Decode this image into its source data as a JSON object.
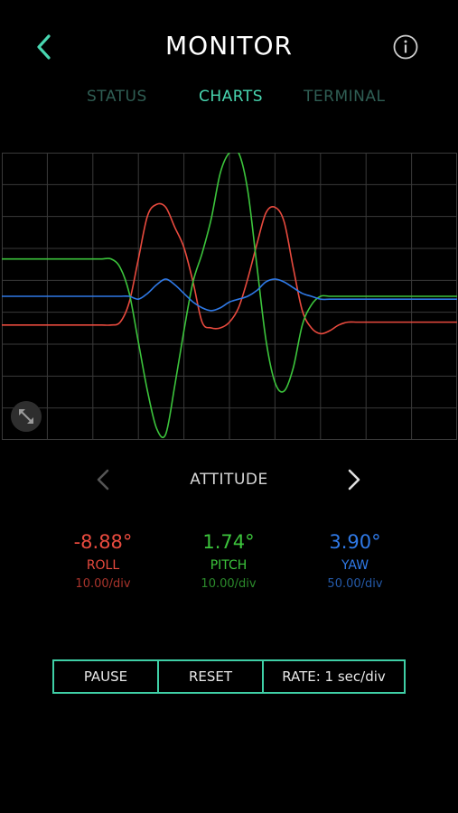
{
  "header": {
    "title": "MONITOR",
    "back_icon": "chevron-left-icon",
    "info_icon": "info-icon"
  },
  "tabs": [
    {
      "label": "STATUS",
      "active": false
    },
    {
      "label": "CHARTS",
      "active": true
    },
    {
      "label": "TERMINAL",
      "active": false
    }
  ],
  "colors": {
    "accent": "#48d6b0",
    "roll": "#e84a3e",
    "pitch": "#3cc43c",
    "yaw": "#2f79e6",
    "grid": "#3a3a3a"
  },
  "chart_data": {
    "type": "line",
    "grid": true,
    "ylim": [
      -5,
      5
    ],
    "x": [
      0,
      2,
      4,
      5,
      6,
      7,
      8,
      9,
      10,
      11,
      12,
      13,
      14,
      15,
      16,
      17,
      18,
      19,
      20,
      21,
      22,
      23,
      24,
      25,
      26,
      27,
      28,
      29,
      30,
      31,
      32,
      33,
      34,
      35,
      36,
      37,
      38,
      39,
      40,
      42,
      44,
      46,
      48,
      50
    ],
    "series": [
      {
        "name": "ROLL",
        "color": "#e84a3e",
        "values": [
          -1,
          -1,
          -1,
          -1,
          -1,
          -1,
          -1,
          -1,
          -1,
          -1,
          -1,
          -0.9,
          -0.2,
          1.3,
          2.8,
          3.2,
          3.1,
          2.4,
          1.7,
          0.5,
          -0.9,
          -1.1,
          -1.1,
          -0.9,
          -0.4,
          0.6,
          1.8,
          2.9,
          3.1,
          2.6,
          1.0,
          -0.5,
          -1.1,
          -1.3,
          -1.2,
          -1.0,
          -0.9,
          -0.9,
          -0.9,
          -0.9,
          -0.9,
          -0.9,
          -0.9,
          -0.9
        ]
      },
      {
        "name": "PITCH",
        "color": "#3cc43c",
        "values": [
          1.3,
          1.3,
          1.3,
          1.3,
          1.3,
          1.3,
          1.3,
          1.3,
          1.3,
          1.3,
          1.3,
          1.0,
          0.1,
          -1.6,
          -3.3,
          -4.6,
          -4.8,
          -3.1,
          -1.2,
          0.5,
          1.5,
          2.7,
          4.3,
          5.0,
          5.0,
          3.7,
          1.1,
          -1.5,
          -3.0,
          -3.3,
          -2.5,
          -1.0,
          -0.3,
          0,
          0,
          0,
          0,
          0,
          0,
          0,
          0,
          0,
          0,
          0
        ]
      },
      {
        "name": "YAW",
        "color": "#2f79e6",
        "values": [
          0,
          0,
          0,
          0,
          0,
          0,
          0,
          0,
          0,
          0,
          0,
          0,
          0,
          -0.1,
          0.1,
          0.4,
          0.6,
          0.4,
          0.1,
          -0.2,
          -0.4,
          -0.5,
          -0.4,
          -0.2,
          -0.1,
          0,
          0.2,
          0.5,
          0.6,
          0.5,
          0.3,
          0.1,
          0,
          -0.1,
          -0.1,
          -0.1,
          -0.1,
          -0.1,
          -0.1,
          -0.1,
          -0.1,
          -0.1,
          -0.1,
          -0.1
        ]
      }
    ]
  },
  "selector": {
    "label": "ATTITUDE",
    "prev_icon": "chevron-left-icon",
    "next_icon": "chevron-right-icon"
  },
  "readouts": {
    "roll": {
      "value": "-8.88°",
      "label": "ROLL",
      "scale": "10.00/div",
      "color": "#e84a3e",
      "scale_color": "#a8332b"
    },
    "pitch": {
      "value": "1.74°",
      "label": "PITCH",
      "scale": "10.00/div",
      "color": "#3cc43c",
      "scale_color": "#2b8a2b"
    },
    "yaw": {
      "value": "3.90°",
      "label": "YAW",
      "scale": "50.00/div",
      "color": "#2f79e6",
      "scale_color": "#2459a8"
    }
  },
  "buttons": {
    "pause": "PAUSE",
    "reset": "RESET",
    "rate": "RATE: 1 sec/div"
  }
}
